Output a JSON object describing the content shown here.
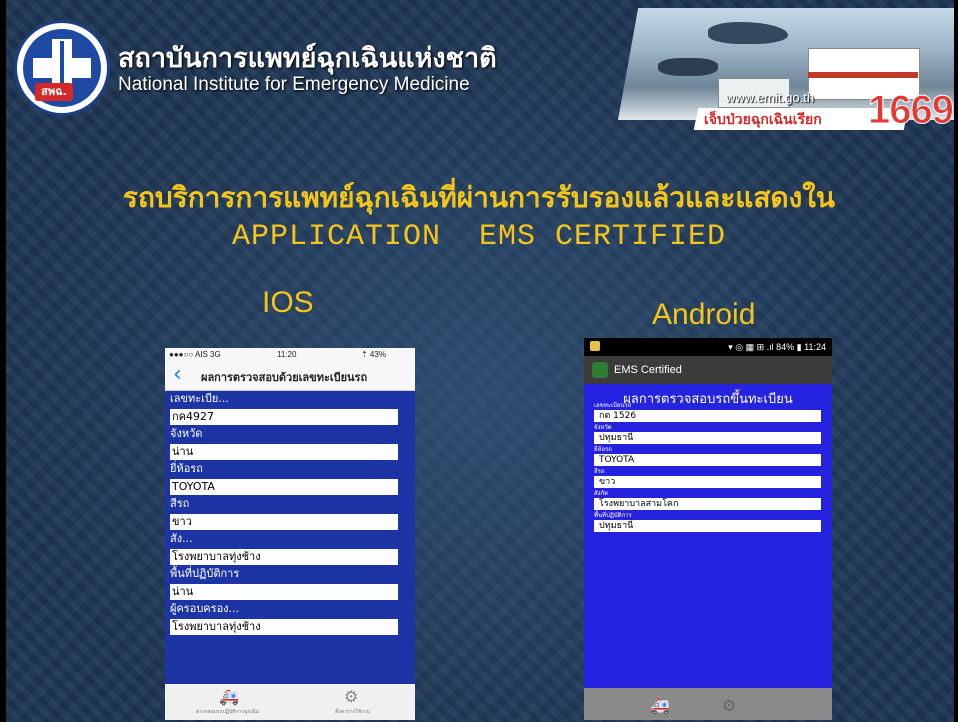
{
  "header": {
    "org_name_th": "สถาบันการแพทย์ฉุกเฉินแห่งชาติ",
    "org_name_en": "National Institute for Emergency Medicine",
    "logo_badge": "สพฉ.",
    "website": "www.emit.go.th",
    "hotline_text": "เจ็บป่วยฉุกเฉินเรียก",
    "hotline_number": "1669"
  },
  "title": {
    "line1": "รถบริการการแพทย์ฉุกเฉินที่ผ่านการรับรองแล้วและแสดงใน",
    "line2": "APPLICATION  EMS CERTIFIED"
  },
  "labels": {
    "ios": "IOS",
    "android": "Android"
  },
  "ios": {
    "status": {
      "carrier": "●●●○○ AIS  3G",
      "time": "11:20",
      "battery": "⇡ 43%"
    },
    "nav_title": "ผลการตรวจสอบด้วยเลขทะเบียนรถ",
    "fields": [
      {
        "label": "เลขทะเบีย...",
        "value": "กค4927"
      },
      {
        "label": "จังหวัด",
        "value": "น่าน"
      },
      {
        "label": "ยี่ห้อรถ",
        "value": "TOYOTA"
      },
      {
        "label": "สีรถ",
        "value": "ขาว"
      },
      {
        "label": "สัง...",
        "value": "โรงพยาบาลทุ่งช้าง"
      },
      {
        "label": "พื้นที่ปฏิบัติการ",
        "value": "น่าน"
      },
      {
        "label": "ผู้ครอบครอง...",
        "value": "โรงพยาบาลทุ่งช้าง"
      }
    ],
    "tabs": [
      {
        "label": "ตรวจสอบรถปฏิบัติการฉุกเฉิน",
        "icon": "ambulance-icon"
      },
      {
        "label": "ตั้งค่าการใช้งาน",
        "icon": "gear-icon"
      }
    ]
  },
  "android": {
    "status": {
      "right": "▾ ◎ ▦ ⊞ .ıl 84% ▮ 11:24"
    },
    "app_name": "EMS Certified",
    "form_title": "ผลการตรวจสอบรถขึ้นทะเบียน",
    "fields": [
      {
        "label": "เลขทะเบียนรถ",
        "value": "กต 1526"
      },
      {
        "label": "จังหวัด",
        "value": "ปทุมธานี"
      },
      {
        "label": "ยี่ห้อรถ",
        "value": "TOYOTA"
      },
      {
        "label": "สีรถ",
        "value": "ขาว"
      },
      {
        "label": "สังกัด",
        "value": "โรงพยาบาลสามโคก"
      },
      {
        "label": "พื้นที่ปฏิบัติการ",
        "value": "ปทุมธานี"
      }
    ]
  },
  "colors": {
    "title_yellow": "#f5c518",
    "ios_form_bg": "#1c34a4",
    "android_form_bg": "#2623e0",
    "hotline_red": "#e53935"
  }
}
